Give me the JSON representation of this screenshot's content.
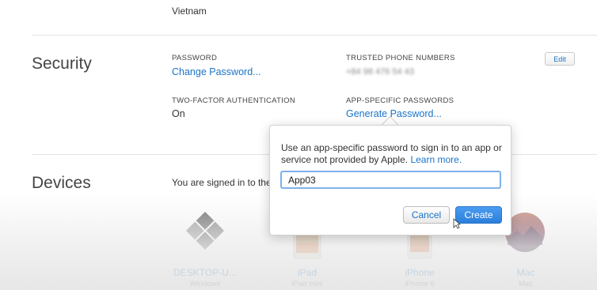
{
  "country": "Vietnam",
  "security": {
    "title": "Security",
    "password_label": "PASSWORD",
    "change_password_link": "Change Password...",
    "trusted_phone_label": "TRUSTED PHONE NUMBERS",
    "trusted_phone_value": "+84 98 476 54 43",
    "edit_button": "Edit",
    "two_factor_label": "TWO-FACTOR AUTHENTICATION",
    "two_factor_value": "On",
    "app_specific_label": "APP-SPECIFIC PASSWORDS",
    "generate_password_link": "Generate Password..."
  },
  "devices": {
    "title": "Devices",
    "intro": "You are signed in to the",
    "items": [
      {
        "name": "DESKTOP-U...",
        "model": "Windows",
        "icon": "windows-logo-icon"
      },
      {
        "name": "iPad",
        "model": "iPad mini",
        "icon": "ipad-icon"
      },
      {
        "name": "iPhone",
        "model": "iPhone 6",
        "icon": "iphone-icon"
      },
      {
        "name": "Mac",
        "model": "Mac",
        "icon": "macos-icon"
      }
    ]
  },
  "popover": {
    "text": "Use an app-specific password to sign in to an app or service not provided by Apple.",
    "learn_more": "Learn more.",
    "input_value": "App03",
    "cancel_label": "Cancel",
    "create_label": "Create"
  },
  "colors": {
    "link": "#1a73c8",
    "primary_button": "#2b7fdc",
    "input_focus": "#7fb0ea"
  }
}
